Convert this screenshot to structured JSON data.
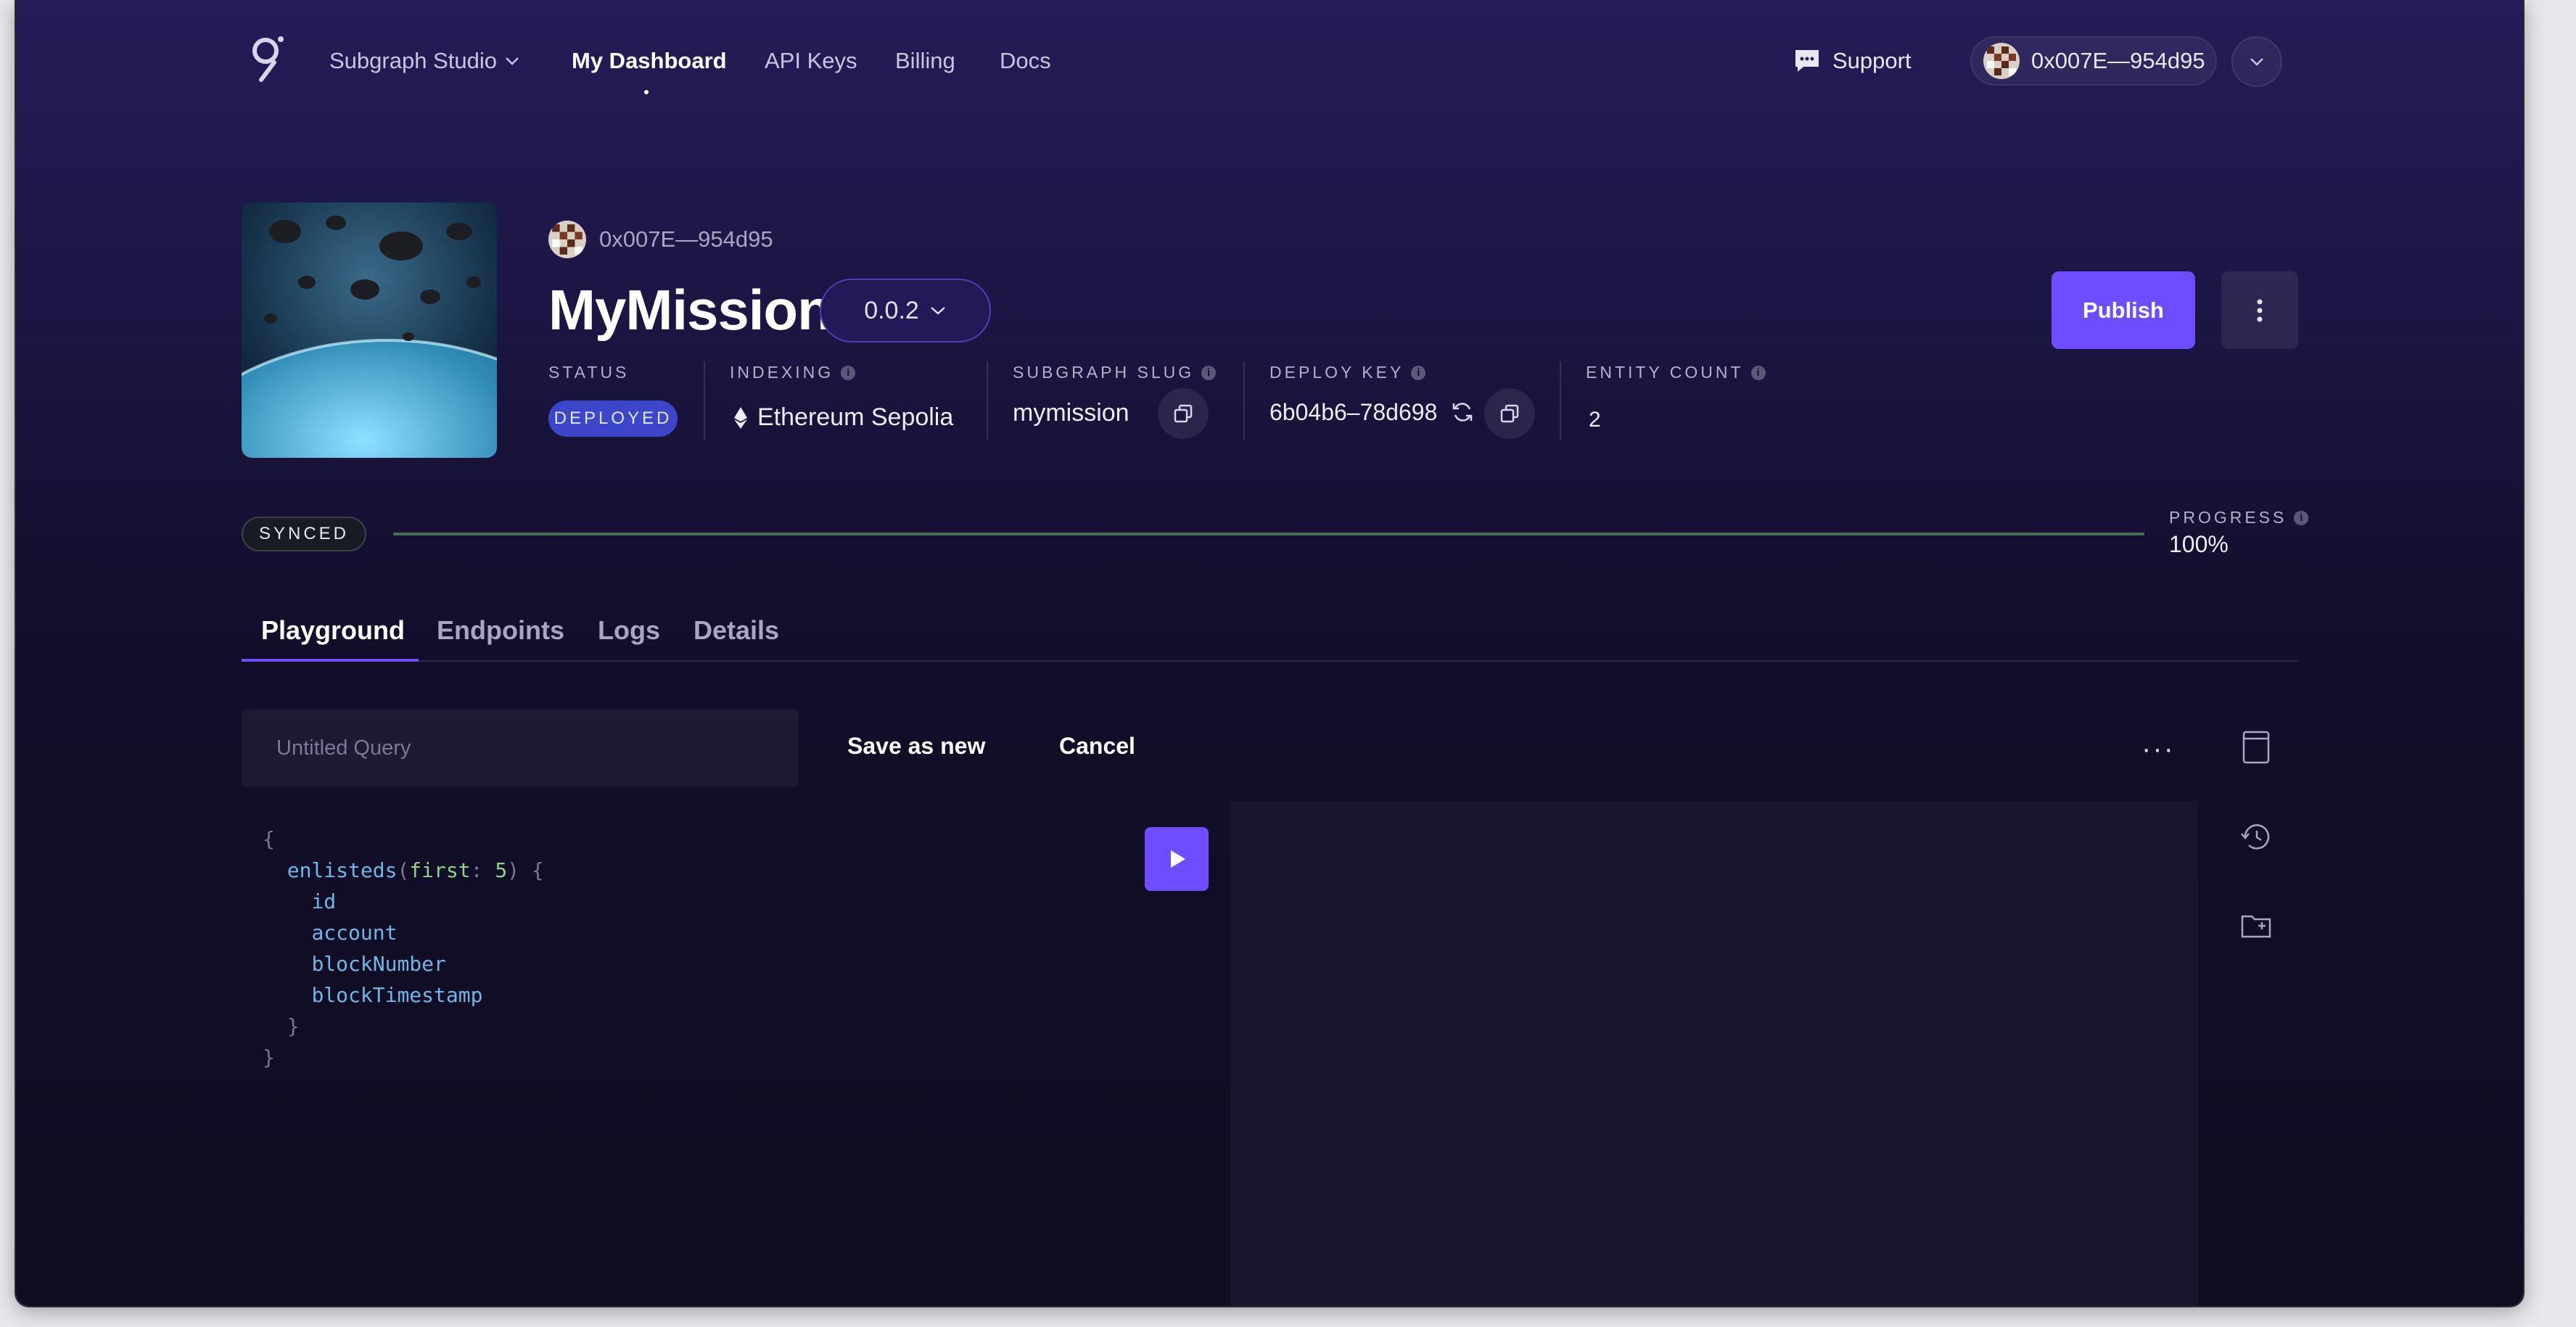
{
  "nav": {
    "brand_menu": "Subgraph Studio",
    "links": [
      "My Dashboard",
      "API Keys",
      "Billing",
      "Docs"
    ],
    "support": "Support",
    "account": "0x007E—954d95"
  },
  "header": {
    "owner": "0x007E—954d95",
    "title": "MyMission",
    "version": "0.0.2",
    "publish": "Publish"
  },
  "meta": {
    "status_label": "STATUS",
    "status_value": "DEPLOYED",
    "indexing_label": "INDEXING",
    "indexing_value": "Ethereum Sepolia",
    "slug_label": "SUBGRAPH SLUG",
    "slug_value": "mymission",
    "deploy_key_label": "DEPLOY KEY",
    "deploy_key_value": "6b04b6–78d698",
    "entity_label": "ENTITY COUNT",
    "entity_value": "2"
  },
  "sync": {
    "badge": "SYNCED",
    "progress_label": "PROGRESS",
    "progress_text": "100%",
    "progress_fraction": 1.0
  },
  "tabs": [
    "Playground",
    "Endpoints",
    "Logs",
    "Details"
  ],
  "playground": {
    "query_name_placeholder": "Untitled Query",
    "save_as_new": "Save as new",
    "cancel": "Cancel",
    "more": "···",
    "code": {
      "open_brace": "{",
      "entity": "enlisteds",
      "arg_name": "first",
      "arg_value": "5",
      "fields": [
        "id",
        "account",
        "blockNumber",
        "blockTimestamp"
      ],
      "close_inner": "}",
      "close_outer": "}"
    }
  },
  "colors": {
    "accent": "#6f4cff",
    "deployed_badge": "#3c46c8",
    "background_top": "#251c58",
    "background_bottom": "#0f0c20"
  }
}
